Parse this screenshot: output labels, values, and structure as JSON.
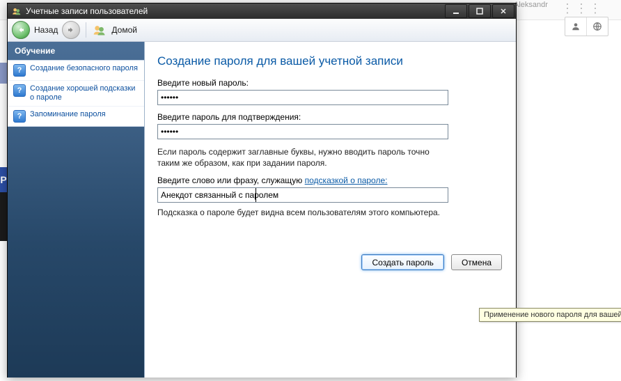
{
  "bg": {
    "username_fragment": "Aleksandr",
    "left_letter": "P"
  },
  "window": {
    "title": "Учетные записи пользователей",
    "back_label": "Назад",
    "home_label": "Домой"
  },
  "sidebar": {
    "heading": "Обучение",
    "items": [
      {
        "label": "Создание безопасного пароля"
      },
      {
        "label": "Создание хорошей подсказки о пароле"
      },
      {
        "label": "Запоминание пароля"
      }
    ]
  },
  "page": {
    "heading": "Создание пароля для вашей учетной записи",
    "new_pw_label": "Введите новый пароль:",
    "new_pw_value": "••••••",
    "confirm_label": "Введите пароль для подтверждения:",
    "confirm_value": "••••••",
    "caps_note": "Если пароль содержит заглавные буквы, нужно вводить пароль точно таким же образом, как при задании пароля.",
    "hint_label_pre": "Введите слово или фразу, служащую ",
    "hint_label_link": "подсказкой о пароле:",
    "hint_value": "Анекдот связанный с паролем",
    "hint_note": "Подсказка о пароле будет видна всем пользователям этого компьютера.",
    "create_btn": "Создать пароль",
    "cancel_btn": "Отмена",
    "tooltip": "Применение нового пароля для вашей учетной записи."
  }
}
